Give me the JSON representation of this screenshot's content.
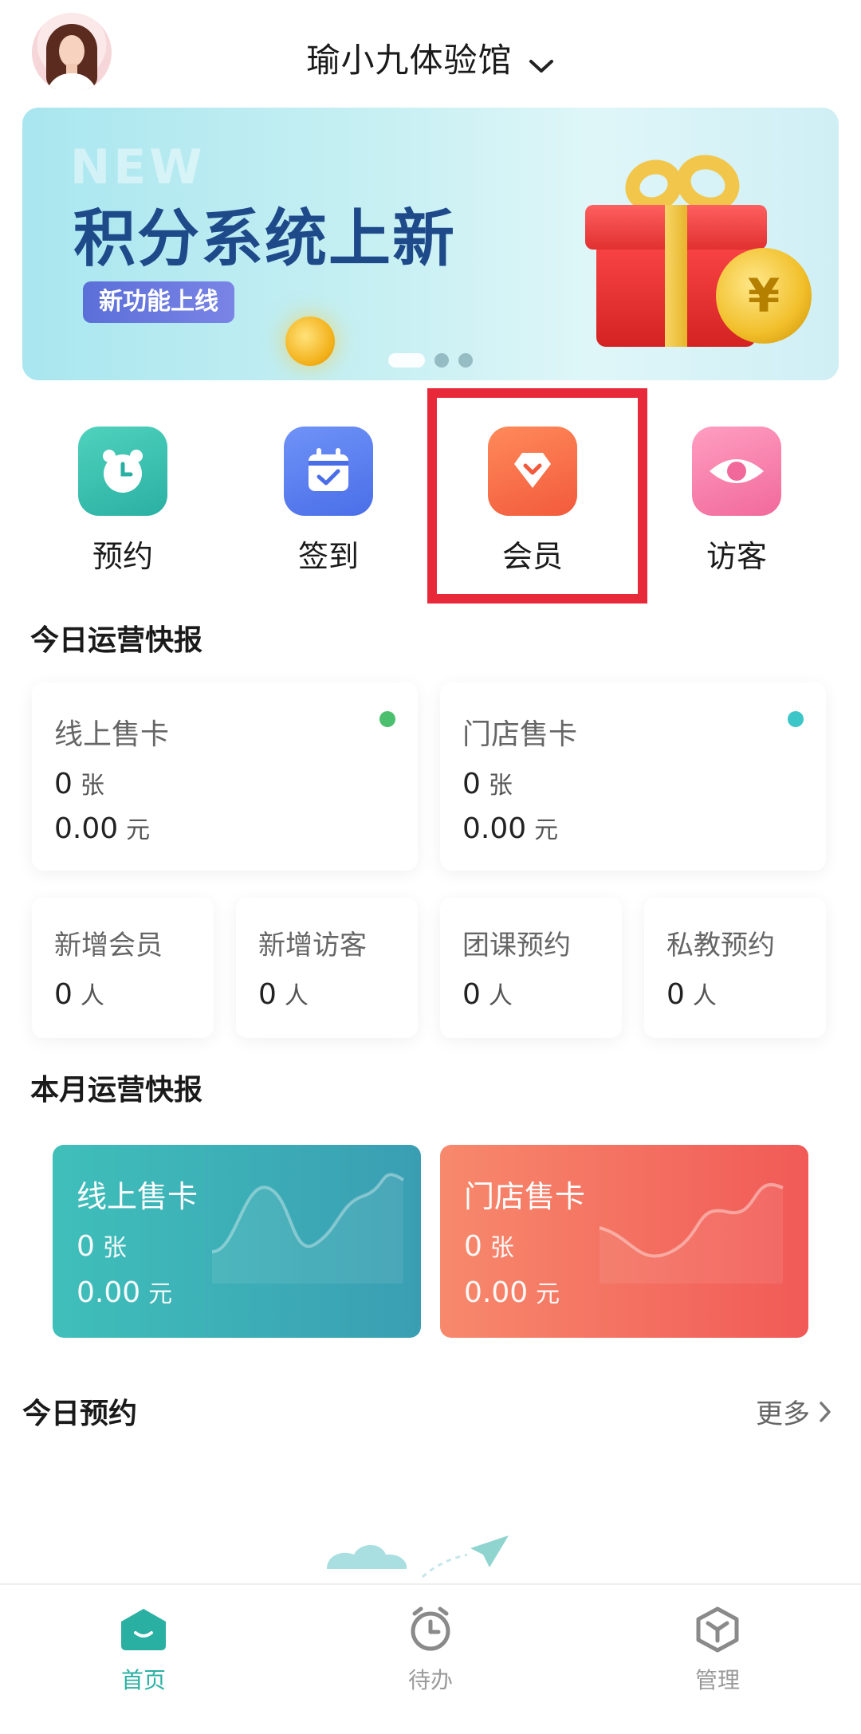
{
  "header": {
    "store_name": "瑜小九体验馆"
  },
  "banner": {
    "ghost_text": "NEW",
    "headline": "积分系统上新",
    "tag": "新功能上线",
    "coin_symbol": "¥",
    "slides": 3,
    "active_slide": 1
  },
  "quick_actions": [
    {
      "label": "预约",
      "icon": "alarm-clock-icon"
    },
    {
      "label": "签到",
      "icon": "calendar-check-icon"
    },
    {
      "label": "会员",
      "icon": "diamond-icon"
    },
    {
      "label": "访客",
      "icon": "eye-icon"
    }
  ],
  "today_report": {
    "title": "今日运营快报",
    "big_cards": [
      {
        "title": "线上售卡",
        "count": "0",
        "count_unit": "张",
        "amount": "0.00",
        "amount_unit": "元",
        "indicator_color": "#4cbf6e"
      },
      {
        "title": "门店售卡",
        "count": "0",
        "count_unit": "张",
        "amount": "0.00",
        "amount_unit": "元",
        "indicator_color": "#3cc6c7"
      }
    ],
    "small_cards": [
      {
        "title": "新增会员",
        "value": "0",
        "unit": "人"
      },
      {
        "title": "新增访客",
        "value": "0",
        "unit": "人"
      },
      {
        "title": "团课预约",
        "value": "0",
        "unit": "人"
      },
      {
        "title": "私教预约",
        "value": "0",
        "unit": "人"
      }
    ]
  },
  "month_report": {
    "title": "本月运营快报",
    "cards": [
      {
        "title": "线上售卡",
        "count": "0",
        "count_unit": "张",
        "amount": "0.00",
        "amount_unit": "元"
      },
      {
        "title": "门店售卡",
        "count": "0",
        "count_unit": "张",
        "amount": "0.00",
        "amount_unit": "元"
      }
    ]
  },
  "today_booking": {
    "title": "今日预约",
    "more": "更多"
  },
  "bottom_nav": [
    {
      "label": "首页",
      "icon": "home-icon",
      "active": true
    },
    {
      "label": "待办",
      "icon": "clock-icon",
      "active": false
    },
    {
      "label": "管理",
      "icon": "cube-icon",
      "active": false
    }
  ],
  "colors": {
    "accent": "#2ab0a3",
    "highlight_box": "#e8293a",
    "inactive_tab": "#9a9a9a"
  }
}
